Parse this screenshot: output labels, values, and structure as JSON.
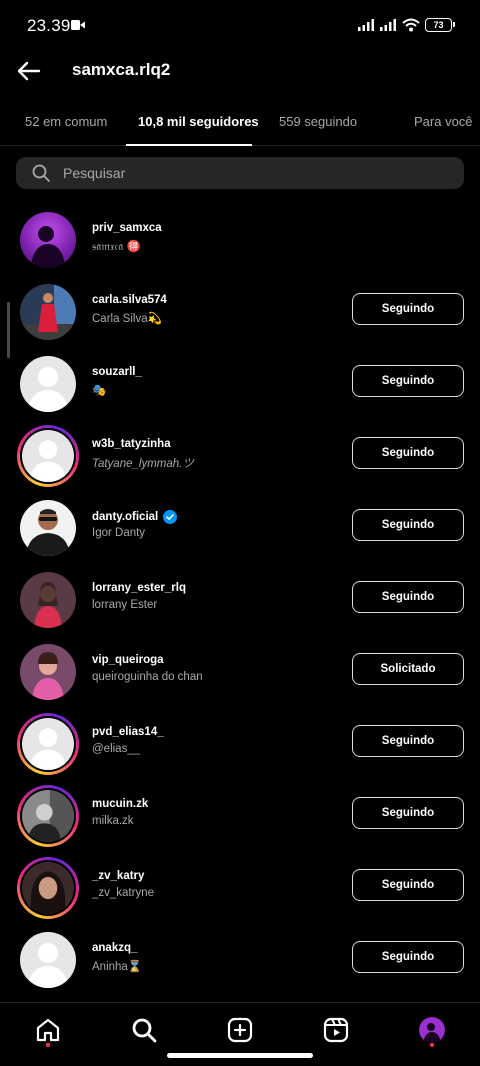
{
  "status_bar": {
    "time": "23.39",
    "battery": "73"
  },
  "header": {
    "title": "samxca.rlq2"
  },
  "tabs": [
    {
      "label": "52 em comum"
    },
    {
      "label": "10,8 mil seguidores"
    },
    {
      "label": "559 seguindo"
    },
    {
      "label": "Para você"
    }
  ],
  "search": {
    "placeholder": "Pesquisar"
  },
  "accounts": [
    {
      "username": "priv_samxca",
      "name": "𝔰𝔞𝔪𝔵𝔠𝔞 🉐",
      "button": ""
    },
    {
      "username": "carla.silva574",
      "name": "Carla Silva💫",
      "button": "Seguindo"
    },
    {
      "username": "souzarll_",
      "name": "🎭",
      "button": "Seguindo"
    },
    {
      "username": "w3b_tatyzinha",
      "name": "Tatyane_lymmah.ツ",
      "button": "Seguindo"
    },
    {
      "username": "danty.oficial",
      "name": "Igor Danty",
      "button": "Seguindo",
      "verified": true
    },
    {
      "username": "lorrany_ester_rlq",
      "name": "lorrany Ester",
      "button": "Seguindo"
    },
    {
      "username": "vip_queiroga",
      "name": "queiroguinha do chan",
      "button": "Solicitado"
    },
    {
      "username": "pvd_elias14_",
      "name": "@elias__",
      "button": "Seguindo"
    },
    {
      "username": "mucuin.zk",
      "name": "milka.zk",
      "button": "Seguindo"
    },
    {
      "username": "_zv_katry",
      "name": "_zv_katryne",
      "button": "Seguindo"
    },
    {
      "username": "anakzq_",
      "name": "Aninha⌛",
      "button": "Seguindo"
    }
  ],
  "colors": {
    "background": "#000000",
    "secondary_text": "#a8a8a8",
    "verified": "#0095f6",
    "notification_dot": "#ff3040"
  },
  "bottom_nav": [
    "home-icon",
    "search-icon",
    "create-icon",
    "reels-icon",
    "profile-avatar"
  ]
}
